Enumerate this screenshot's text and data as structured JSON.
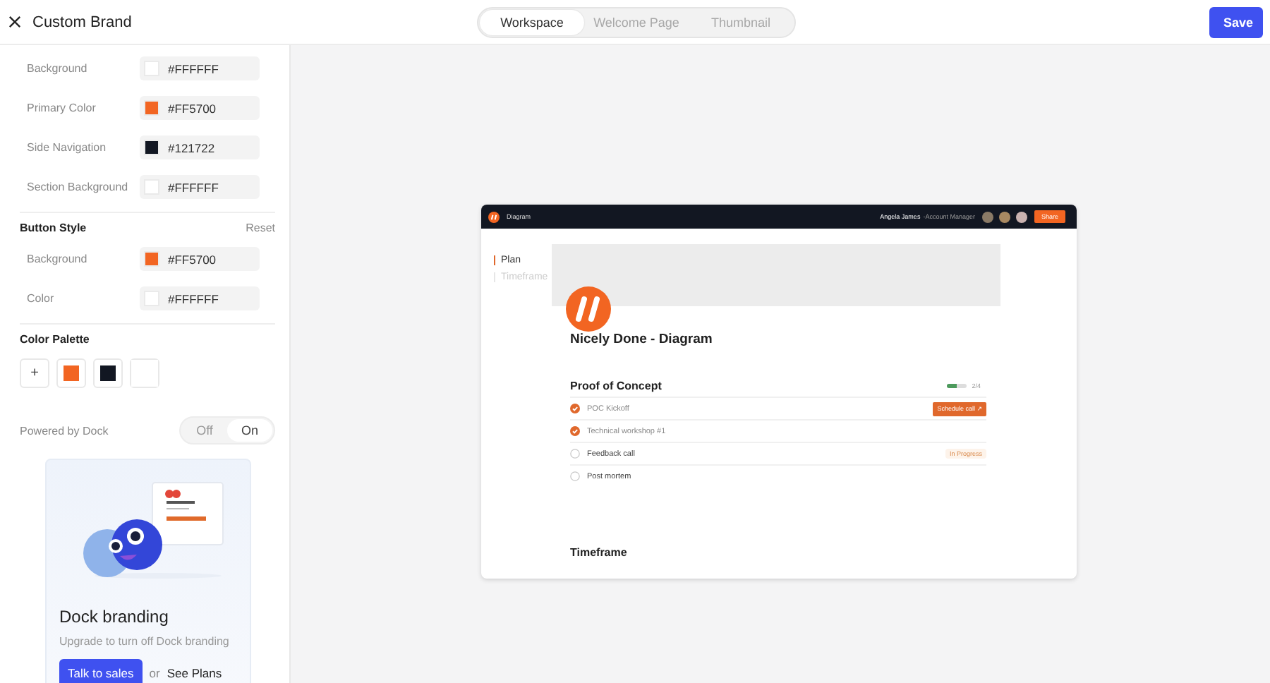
{
  "header": {
    "title": "Custom Brand",
    "tabs": [
      {
        "label": "Workspace",
        "selected": true
      },
      {
        "label": "Welcome Page",
        "selected": false
      },
      {
        "label": "Thumbnail",
        "selected": false
      }
    ],
    "save": "Save"
  },
  "colors": [
    {
      "label": "Background",
      "value": "#FFFFFF",
      "color": "#ffffff"
    },
    {
      "label": "Primary Color",
      "value": "#FF5700",
      "color": "#f26522"
    },
    {
      "label": "Side Navigation",
      "value": "#121722",
      "color": "#121722"
    },
    {
      "label": "Section Background",
      "value": "#FFFFFF",
      "color": "#ffffff"
    }
  ],
  "button_style": {
    "title": "Button Style",
    "reset": "Reset",
    "fields": [
      {
        "label": "Background",
        "value": "#FF5700",
        "color": "#f26522"
      },
      {
        "label": "Color",
        "value": "#FFFFFF",
        "color": "#ffffff"
      }
    ]
  },
  "palette": {
    "title": "Color Palette",
    "add": "+",
    "swatches": [
      {
        "color": "#f26522"
      },
      {
        "color": "#121722"
      },
      {
        "color": "#ffffff"
      }
    ]
  },
  "powered": {
    "label": "Powered by Dock",
    "options": [
      {
        "label": "Off",
        "selected": false
      },
      {
        "label": "On",
        "selected": true
      }
    ]
  },
  "promo": {
    "title": "Dock branding",
    "text": "Upgrade to turn off Dock branding",
    "cta": "Talk to sales",
    "or": "or",
    "link": "See Plans"
  },
  "preview": {
    "topbar": {
      "name": "Diagram",
      "user": "Angela James",
      "role": "-Account Manager",
      "share": "Share"
    },
    "nav": [
      {
        "label": "Plan",
        "selected": true
      },
      {
        "label": "Timeframe",
        "selected": false
      }
    ],
    "title": "Nicely Done - Diagram",
    "plan": {
      "title": "Proof of Concept",
      "progress": {
        "level": 0.5,
        "count": "2/4"
      },
      "tasks": [
        {
          "label": "POC Kickoff",
          "checked": true,
          "badge": {
            "kind": "button",
            "text": "Schedule call ↗"
          }
        },
        {
          "label": "Technical workshop #1",
          "checked": true
        },
        {
          "label": "Feedback call",
          "checked": false,
          "badge": {
            "kind": "status",
            "text": "In Progress"
          }
        },
        {
          "label": "Post mortem",
          "checked": false
        }
      ]
    },
    "section": "Timeframe"
  }
}
